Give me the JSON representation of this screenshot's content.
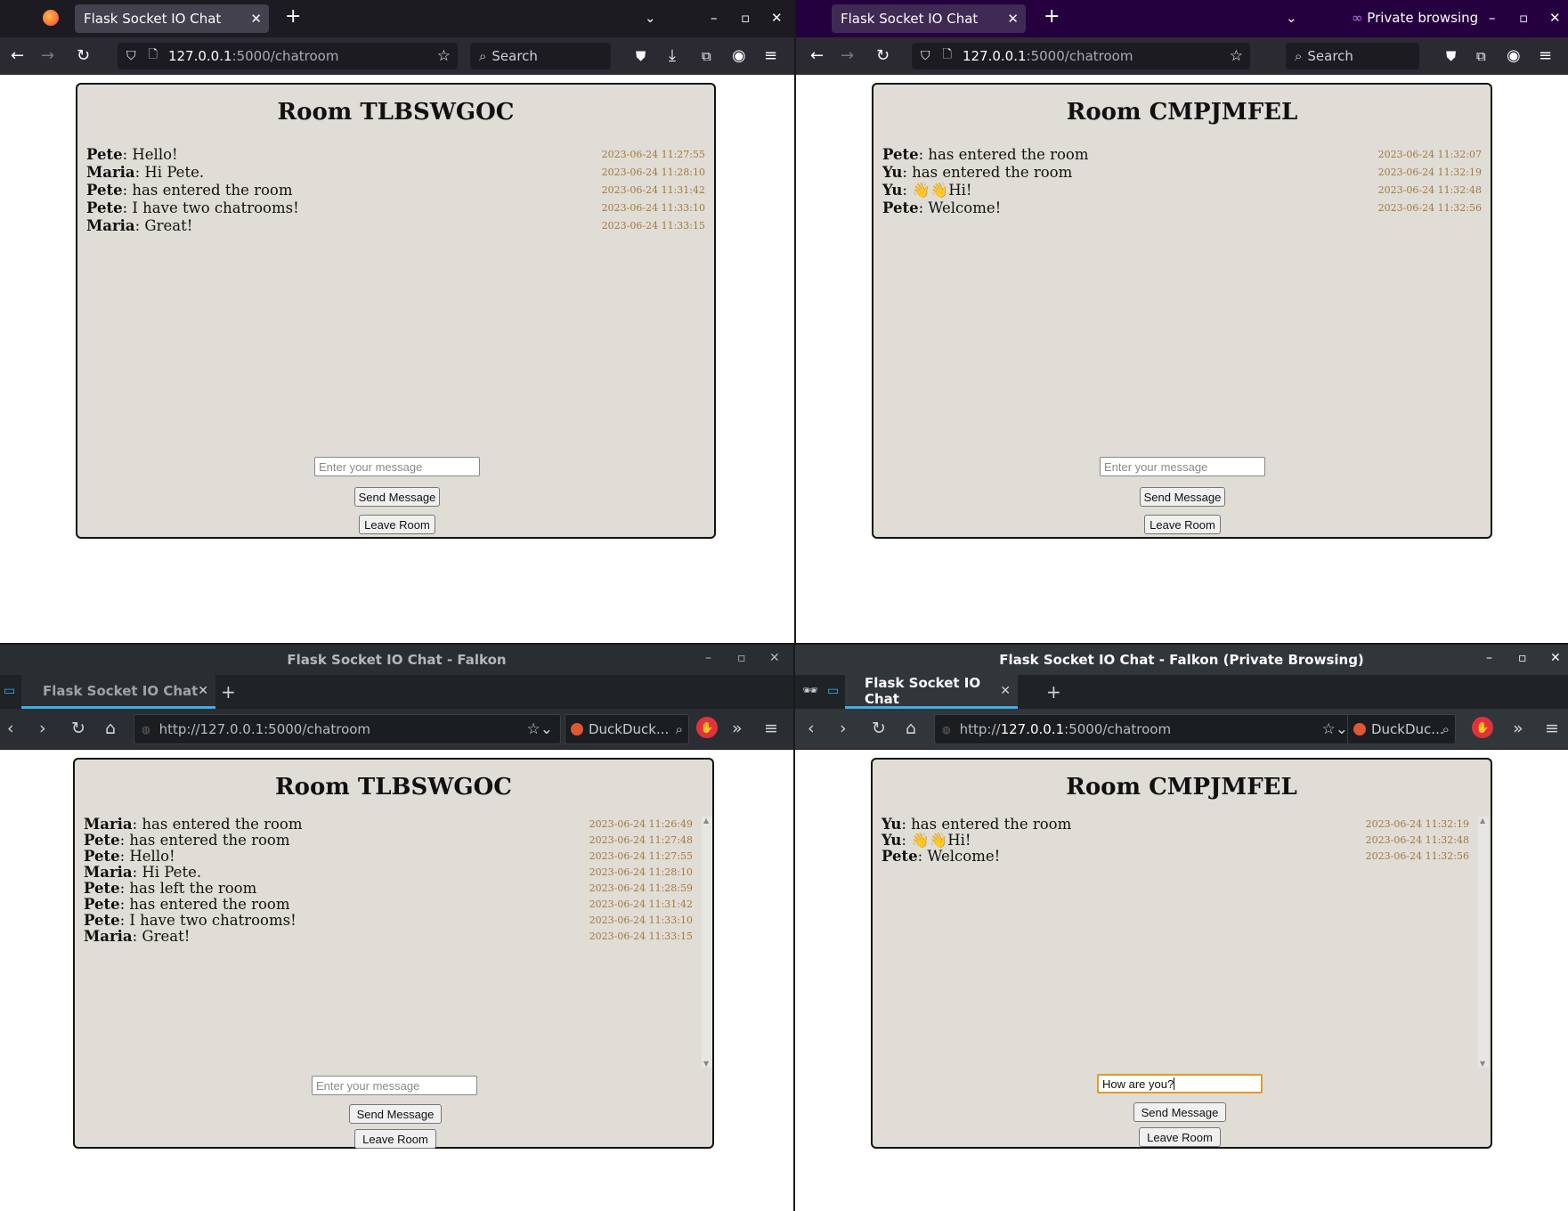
{
  "firefox_normal": {
    "tab_title": "Flask Socket IO Chat",
    "url_host": "127.0.0.1",
    "url_rest": ":5000/chatroom",
    "search_placeholder": "Search",
    "room_title": "Room TLBSWGOC",
    "messages": [
      {
        "user": "Pete",
        "text": ": Hello!",
        "time": "2023-06-24 11:27:55"
      },
      {
        "user": "Maria",
        "text": ": Hi Pete.",
        "time": "2023-06-24 11:28:10"
      },
      {
        "user": "Pete",
        "text": ": has entered the room",
        "time": "2023-06-24 11:31:42"
      },
      {
        "user": "Pete",
        "text": ": I have two chatrooms!",
        "time": "2023-06-24 11:33:10"
      },
      {
        "user": "Maria",
        "text": ": Great!",
        "time": "2023-06-24 11:33:15"
      }
    ],
    "input_placeholder": "Enter your message",
    "send_label": "Send Message",
    "leave_label": "Leave Room"
  },
  "firefox_private": {
    "tab_title": "Flask Socket IO Chat",
    "private_label": "Private browsing",
    "url_host": "127.0.0.1",
    "url_rest": ":5000/chatroom",
    "search_placeholder": "Search",
    "room_title": "Room CMPJMFEL",
    "messages": [
      {
        "user": "Pete",
        "text": ": has entered the room",
        "time": "2023-06-24 11:32:07"
      },
      {
        "user": "Yu",
        "text": ": has entered the room",
        "time": "2023-06-24 11:32:19"
      },
      {
        "user": "Yu",
        "text": ": 👋👋Hi!",
        "time": "2023-06-24 11:32:48"
      },
      {
        "user": "Pete",
        "text": ": Welcome!",
        "time": "2023-06-24 11:32:56"
      }
    ],
    "input_placeholder": "Enter your message",
    "send_label": "Send Message",
    "leave_label": "Leave Room"
  },
  "falkon_normal": {
    "window_title": "Flask Socket IO Chat - Falkon",
    "tab_title": "Flask Socket IO Chat",
    "url": "http://127.0.0.1:5000/chatroom",
    "search_engine": "DuckDuck...",
    "room_title": "Room TLBSWGOC",
    "messages": [
      {
        "user": "Maria",
        "text": ": has entered the room",
        "time": "2023-06-24 11:26:49"
      },
      {
        "user": "Pete",
        "text": ": has entered the room",
        "time": "2023-06-24 11:27:48"
      },
      {
        "user": "Pete",
        "text": ": Hello!",
        "time": "2023-06-24 11:27:55"
      },
      {
        "user": "Maria",
        "text": ": Hi Pete.",
        "time": "2023-06-24 11:28:10"
      },
      {
        "user": "Pete",
        "text": ": has left the room",
        "time": "2023-06-24 11:28:59"
      },
      {
        "user": "Pete",
        "text": ": has entered the room",
        "time": "2023-06-24 11:31:42"
      },
      {
        "user": "Pete",
        "text": ": I have two chatrooms!",
        "time": "2023-06-24 11:33:10"
      },
      {
        "user": "Maria",
        "text": ": Great!",
        "time": "2023-06-24 11:33:15"
      }
    ],
    "input_placeholder": "Enter your message",
    "send_label": "Send Message",
    "leave_label": "Leave Room"
  },
  "falkon_private": {
    "window_title": "Flask Socket IO Chat - Falkon (Private Browsing)",
    "tab_title": "Flask Socket IO Chat",
    "url_prefix": "http://",
    "url_host": "127.0.0.1",
    "url_rest": ":5000/chatroom",
    "search_engine": "DuckDuc...",
    "room_title": "Room CMPJMFEL",
    "messages": [
      {
        "user": "Yu",
        "text": ": has entered the room",
        "time": "2023-06-24 11:32:19"
      },
      {
        "user": "Yu",
        "text": ": 👋👋Hi!",
        "time": "2023-06-24 11:32:48"
      },
      {
        "user": "Pete",
        "text": ": Welcome!",
        "time": "2023-06-24 11:32:56"
      }
    ],
    "input_value": "How are you?",
    "send_label": "Send Message",
    "leave_label": "Leave Room"
  },
  "colors": {
    "chat_bg": "#e0ddd6",
    "timestamp": "#a37a3c",
    "firefox_dark": "#1c1b22",
    "falkon_dark": "#2a2e32",
    "falkon_accent": "#3daee9"
  }
}
